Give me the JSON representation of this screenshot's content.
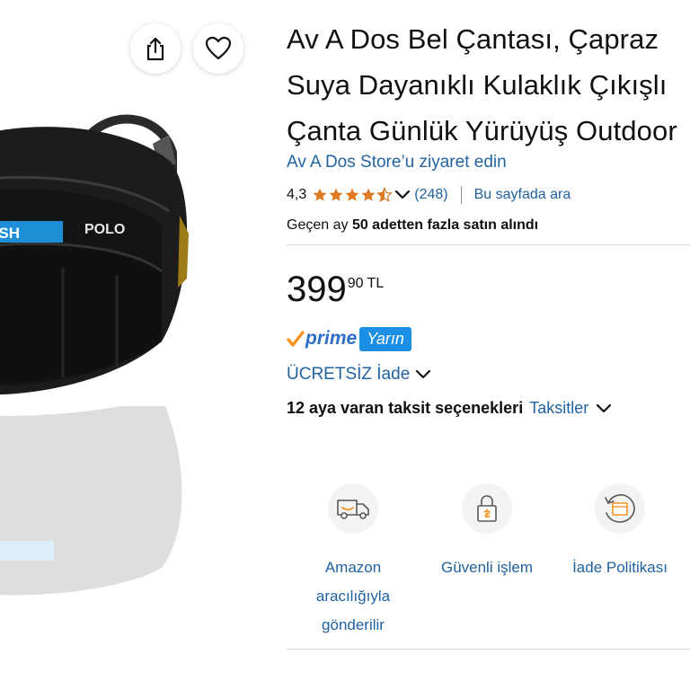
{
  "product": {
    "title_lines": [
      "Av A Dos Bel Çantası, Çapraz",
      "Suya Dayanıklı Kulaklık Çıkışlı",
      "Çanta Günlük Yürüyüş Outdoor"
    ],
    "store_link": "Av A Dos Store’u ziyaret edin",
    "rating": "4,3",
    "rating_count": "(248)",
    "search_on_page": "Bu sayfada ara",
    "bought_prefix": "Geçen ay ",
    "bought_bold": "50 adetten fazla satın alındı",
    "image_labels": {
      "brand": "REWISH",
      "model": "POLO"
    }
  },
  "price": {
    "whole": "399",
    "fraction": "90",
    "currency": "TL"
  },
  "prime": {
    "word": "prime",
    "badge": "Yarın"
  },
  "returns": {
    "label": "ÜCRETSİZ İade"
  },
  "installment": {
    "text": "12 aya varan taksit seçenekleri",
    "link": "Taksitler"
  },
  "features": [
    {
      "icon": "delivery-van-icon",
      "label_lines": [
        "Amazon",
        "aracılığıyla",
        "gönderilir"
      ]
    },
    {
      "icon": "secure-lock-icon",
      "label_lines": [
        "Güvenli işlem"
      ]
    },
    {
      "icon": "return-policy-icon",
      "label_lines": [
        "İade Politikası"
      ]
    }
  ],
  "colors": {
    "link": "#2162a1",
    "text": "#0f1111",
    "star": "#de7921",
    "prime_blue": "#1a8fe3",
    "prime_check": "#f79321"
  }
}
